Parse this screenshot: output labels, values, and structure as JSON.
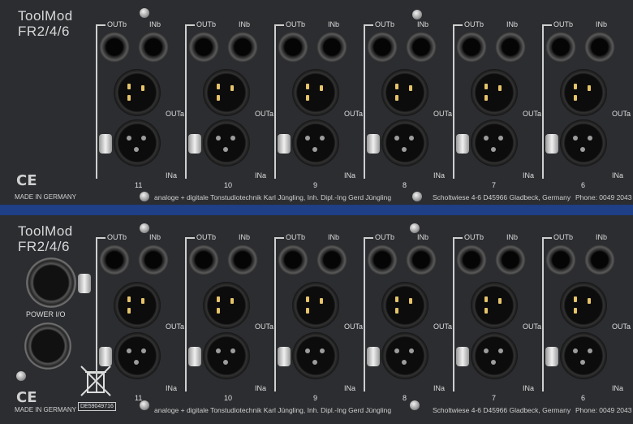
{
  "brand": {
    "line1": "ToolMod",
    "line2": "FR2/4/6"
  },
  "labels": {
    "outb": "OUTb",
    "inb": "INb",
    "outa": "OUTa",
    "ina": "INa"
  },
  "top_channels": [
    "11",
    "10",
    "9",
    "8",
    "7",
    "6"
  ],
  "bottom_channels": [
    "11",
    "10",
    "9",
    "8",
    "7",
    "6"
  ],
  "footer": {
    "ce": "CE",
    "made_in": "MADE IN GERMANY",
    "maker": "analoge + digitale Tonstudiotechnik Karl Jüngling, Inh. Dipl.-Ing Gerd Jüngling",
    "address": "Scholtwiese 4-6  D45966 Gladbeck, Germany",
    "phone": "Phone: 0049 2043"
  },
  "power_label": "POWER I/O",
  "serial": "DE59049716",
  "colors": {
    "panel": "#2b2d30",
    "rack": "#1f3f86",
    "print": "#d8d8d8"
  }
}
